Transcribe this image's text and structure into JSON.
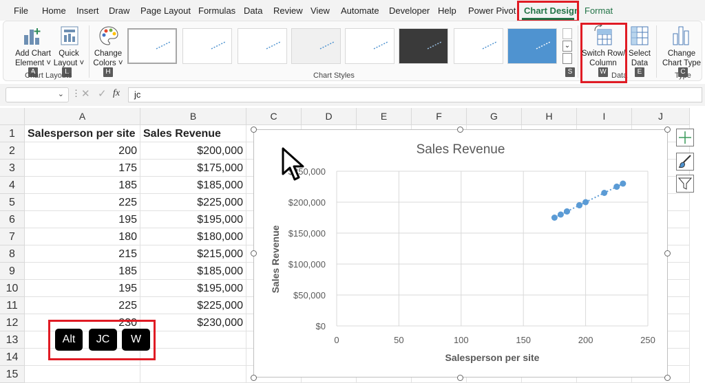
{
  "menu": {
    "tabs": [
      "File",
      "Home",
      "Insert",
      "Draw",
      "Page Layout",
      "Formulas",
      "Data",
      "Review",
      "View",
      "Automate",
      "Developer",
      "Help",
      "Power Pivot",
      "Chart Design",
      "Format"
    ],
    "active_tab": "Chart Design"
  },
  "ribbon": {
    "add_chart_element": {
      "line1": "Add Chart",
      "line2": "Element ˅",
      "key": "A"
    },
    "quick_layout": {
      "line1": "Quick",
      "line2": "Layout ˅",
      "key": "L"
    },
    "chart_layouts_label": "Chart Layouts",
    "change_colors": {
      "line1": "Change",
      "line2": "Colors ˅",
      "key": "H"
    },
    "chart_styles_label": "Chart Styles",
    "styles_key": "S",
    "switch_row_column": {
      "line1": "Switch Row/",
      "line2": "Column",
      "key": "W"
    },
    "select_data": {
      "line1": "Select",
      "line2": "Data",
      "key": "E"
    },
    "data_label": "Data",
    "change_chart_type": {
      "line1": "Change",
      "line2": "Chart Type",
      "key": "C"
    },
    "type_label": "Type"
  },
  "formula_bar": {
    "fx": "fx",
    "value": "jc"
  },
  "columns": [
    "A",
    "B",
    "C",
    "D",
    "E",
    "F",
    "G",
    "H",
    "I",
    "J"
  ],
  "rows": [
    "1",
    "2",
    "3",
    "4",
    "5",
    "6",
    "7",
    "8",
    "9",
    "10",
    "11",
    "12",
    "13",
    "14",
    "15"
  ],
  "table": {
    "headers": [
      "Salesperson per site",
      "Sales Revenue"
    ],
    "rows": [
      [
        "200",
        "$200,000"
      ],
      [
        "175",
        "$175,000"
      ],
      [
        "185",
        "$185,000"
      ],
      [
        "225",
        "$225,000"
      ],
      [
        "195",
        "$195,000"
      ],
      [
        "180",
        "$180,000"
      ],
      [
        "215",
        "$215,000"
      ],
      [
        "185",
        "$185,000"
      ],
      [
        "195",
        "$195,000"
      ],
      [
        "225",
        "$225,000"
      ],
      [
        "230",
        "$230,000"
      ]
    ]
  },
  "keytips_overlay": [
    "Alt",
    "JC",
    "W"
  ],
  "chart_data": {
    "type": "scatter",
    "title": "Sales Revenue",
    "xlabel": "Salesperson per site",
    "ylabel": "Sales Revenue",
    "xlim": [
      0,
      250
    ],
    "ylim": [
      0,
      250000
    ],
    "x_ticks": [
      "0",
      "50",
      "100",
      "150",
      "200",
      "250"
    ],
    "y_ticks": [
      "$0",
      "$50,000",
      "$100,000",
      "$150,000",
      "$200,000",
      "$250,000"
    ],
    "x": [
      200,
      175,
      185,
      225,
      195,
      180,
      215,
      185,
      195,
      225,
      230
    ],
    "y": [
      200000,
      175000,
      185000,
      225000,
      195000,
      180000,
      215000,
      185000,
      195000,
      225000,
      230000
    ],
    "trendline": "linear (dotted)",
    "grid": true,
    "point_color": "#5b9bd5"
  }
}
